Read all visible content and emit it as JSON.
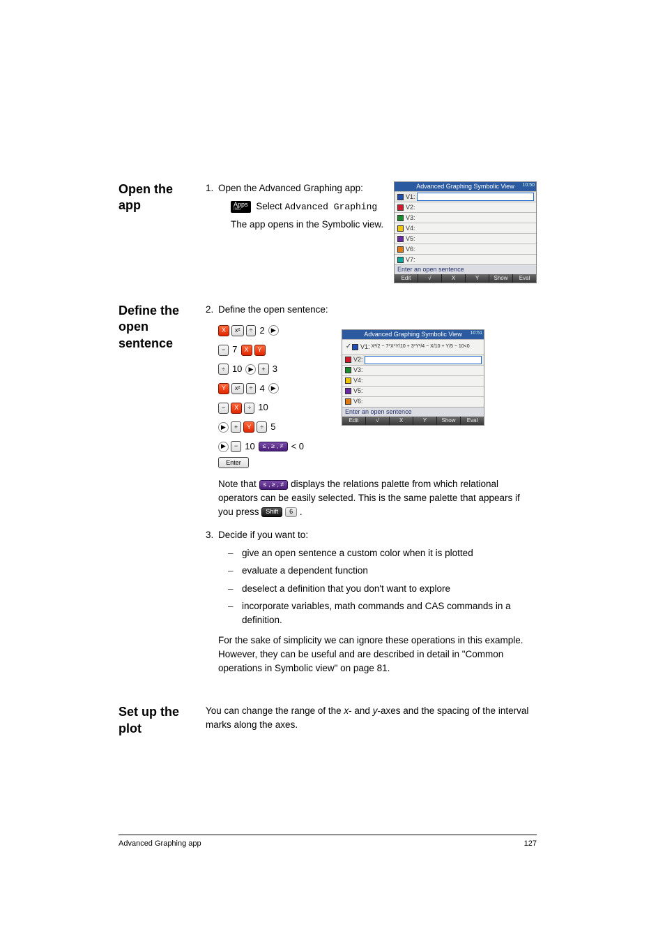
{
  "sections": {
    "open_app": {
      "heading": "Open the app",
      "step_num": "1.",
      "line1": "Open the Advanced Graphing app:",
      "apps_label": "Apps",
      "apps_sub": "Info",
      "select_text": "Select",
      "mono": "Advanced Graphing",
      "line2": "The app opens in the Symbolic view."
    },
    "define": {
      "heading": "Define the open sentence",
      "step2_num": "2.",
      "step2_text": "Define the open sentence:",
      "note_a": "Note that ",
      "note_b": " displays the relations palette from which relational operators can be easily selected. This is the same palette that appears if you press ",
      "note_c": ".",
      "rel_key": "≤ , ≥ , ≠",
      "shift": "Shift",
      "six": "6",
      "step3_num": "3.",
      "step3_text": "Decide if you want to:",
      "sub1": "give an open sentence a custom color when it is plotted",
      "sub2": "evaluate a dependent function",
      "sub3": "deselect a definition that you don't want to explore",
      "sub4": "incorporate variables, math commands and CAS commands in a definition.",
      "closing": "For the sake of simplicity we can ignore these operations in this example. However, they can be useful and are described in detail in \"Common operations in Symbolic view\" on page 81."
    },
    "setup": {
      "heading": "Set up the plot",
      "body_a": "You can change the range of the ",
      "x": "x",
      "body_b": "- and ",
      "y": "y",
      "body_c": "-axes and the spacing of the interval marks along the axes."
    }
  },
  "calc1": {
    "title": "Advanced Graphing Symbolic View",
    "clock": "10:50",
    "rows": [
      "V1:",
      "V2:",
      "V3:",
      "V4:",
      "V5:",
      "V6:",
      "V7:"
    ],
    "msg": "Enter an open sentence",
    "soft": [
      "Edit",
      "√",
      "X",
      "Y",
      "Show",
      "Eval"
    ]
  },
  "calc2": {
    "title": "Advanced Graphing Symbolic View",
    "clock": "10:51",
    "v1_lbl": "V1:",
    "v1_expr": "X²/2 − 7*X*Y/10 + 3*Y²/4 − X/10 + Y/5 − 10<0",
    "rows": [
      "V2:",
      "V3:",
      "V4:",
      "V5:",
      "V6:"
    ],
    "msg": "Enter an open sentence",
    "soft": [
      "Edit",
      "√",
      "X",
      "Y",
      "Show",
      "Eval"
    ]
  },
  "keys": {
    "X": "X",
    "Y": "Y",
    "sq": "x²",
    "div": "÷",
    "minus": "−",
    "plus": "+",
    "right": "▶",
    "rel": "≤ , ≥ , ≠",
    "lt0": "< 0",
    "enter": "Enter",
    "n2": "2",
    "n3": "3",
    "n4": "4",
    "n5": "5",
    "n7": "7",
    "n10": "10"
  },
  "footer": {
    "left": "Advanced Graphing app",
    "right": "127"
  }
}
